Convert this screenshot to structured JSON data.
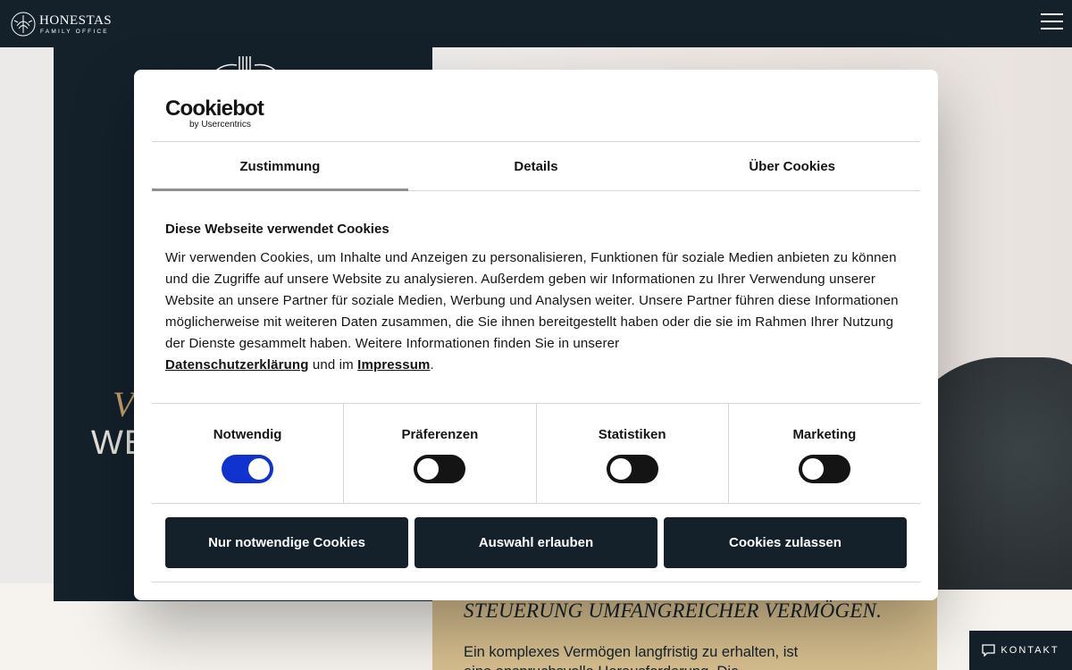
{
  "header": {
    "logo_name": "HONESTAS",
    "logo_subtitle": "FAMILY OFFICE"
  },
  "hero": {
    "line1": "V",
    "line2": "WE"
  },
  "content": {
    "heading": "STEUERUNG UMFANGREICHER VERMÖGEN.",
    "text": "Ein komplexes Vermögen langfristig zu erhalten, ist eine anspruchsvolle Herausforderung. Die Administration ist"
  },
  "kontakt": {
    "label": "KONTAKT"
  },
  "cookie": {
    "brand": "Cookiebot",
    "brand_sub": "by Usercentrics",
    "tabs": [
      {
        "label": "Zustimmung",
        "active": true
      },
      {
        "label": "Details",
        "active": false
      },
      {
        "label": "Über Cookies",
        "active": false
      }
    ],
    "heading": "Diese Webseite verwendet Cookies",
    "body": "Wir verwenden Cookies, um Inhalte und Anzeigen zu personalisieren, Funktionen für soziale Medien anbieten zu können und die Zugriffe auf unsere Website zu analysieren. Außerdem geben wir Informationen zu Ihrer Verwendung unserer Website an unsere Partner für soziale Medien, Werbung und Analysen weiter. Unsere Partner führen diese Informationen möglicherweise mit weiteren Daten zusammen, die Sie ihnen bereitgestellt haben oder die sie im Rahmen Ihrer Nutzung der Dienste gesammelt haben. Weitere Informationen finden Sie in unserer",
    "privacy_link": "Datenschutzerklärung",
    "connector": "und im",
    "imprint_link": "Impressum",
    "end": ".",
    "toggles": [
      {
        "label": "Notwendig",
        "on": true
      },
      {
        "label": "Präferenzen",
        "on": false
      },
      {
        "label": "Statistiken",
        "on": false
      },
      {
        "label": "Marketing",
        "on": false
      }
    ],
    "buttons": {
      "necessary": "Nur notwendige Cookies",
      "selection": "Auswahl erlauben",
      "allow_all": "Cookies zulassen"
    }
  },
  "colors": {
    "navy": "#14212b",
    "gold": "#d6be8e",
    "toggle_on": "#1032cf"
  }
}
